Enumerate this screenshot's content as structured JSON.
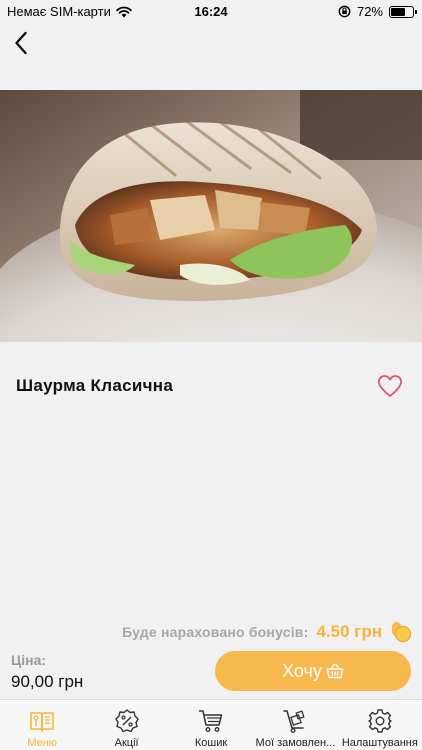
{
  "status_bar": {
    "carrier": "Немає SIM-карти",
    "time": "16:24",
    "battery_percent": "72%",
    "battery_level": 0.72
  },
  "product": {
    "title": "Шаурма Класична",
    "is_favorite": false
  },
  "bonus": {
    "label": "Буде нараховано бонусів:",
    "value": "4.50 грн"
  },
  "price": {
    "label": "Ціна:",
    "value": "90,00 грн"
  },
  "actions": {
    "want_label": "Хочу"
  },
  "tabs": [
    {
      "label": "Меню",
      "icon": "menu-book-icon",
      "active": true
    },
    {
      "label": "Акції",
      "icon": "discount-badge-icon",
      "active": false
    },
    {
      "label": "Кошик",
      "icon": "cart-icon",
      "active": false
    },
    {
      "label": "Мої замовлен...",
      "icon": "orders-trolley-icon",
      "active": false
    },
    {
      "label": "Налаштування",
      "icon": "gear-icon",
      "active": false
    }
  ],
  "colors": {
    "accent": "#f7b94e",
    "accent_text": "#f5b43b",
    "favorite": "#e0526a",
    "background": "#f1f1f1"
  }
}
